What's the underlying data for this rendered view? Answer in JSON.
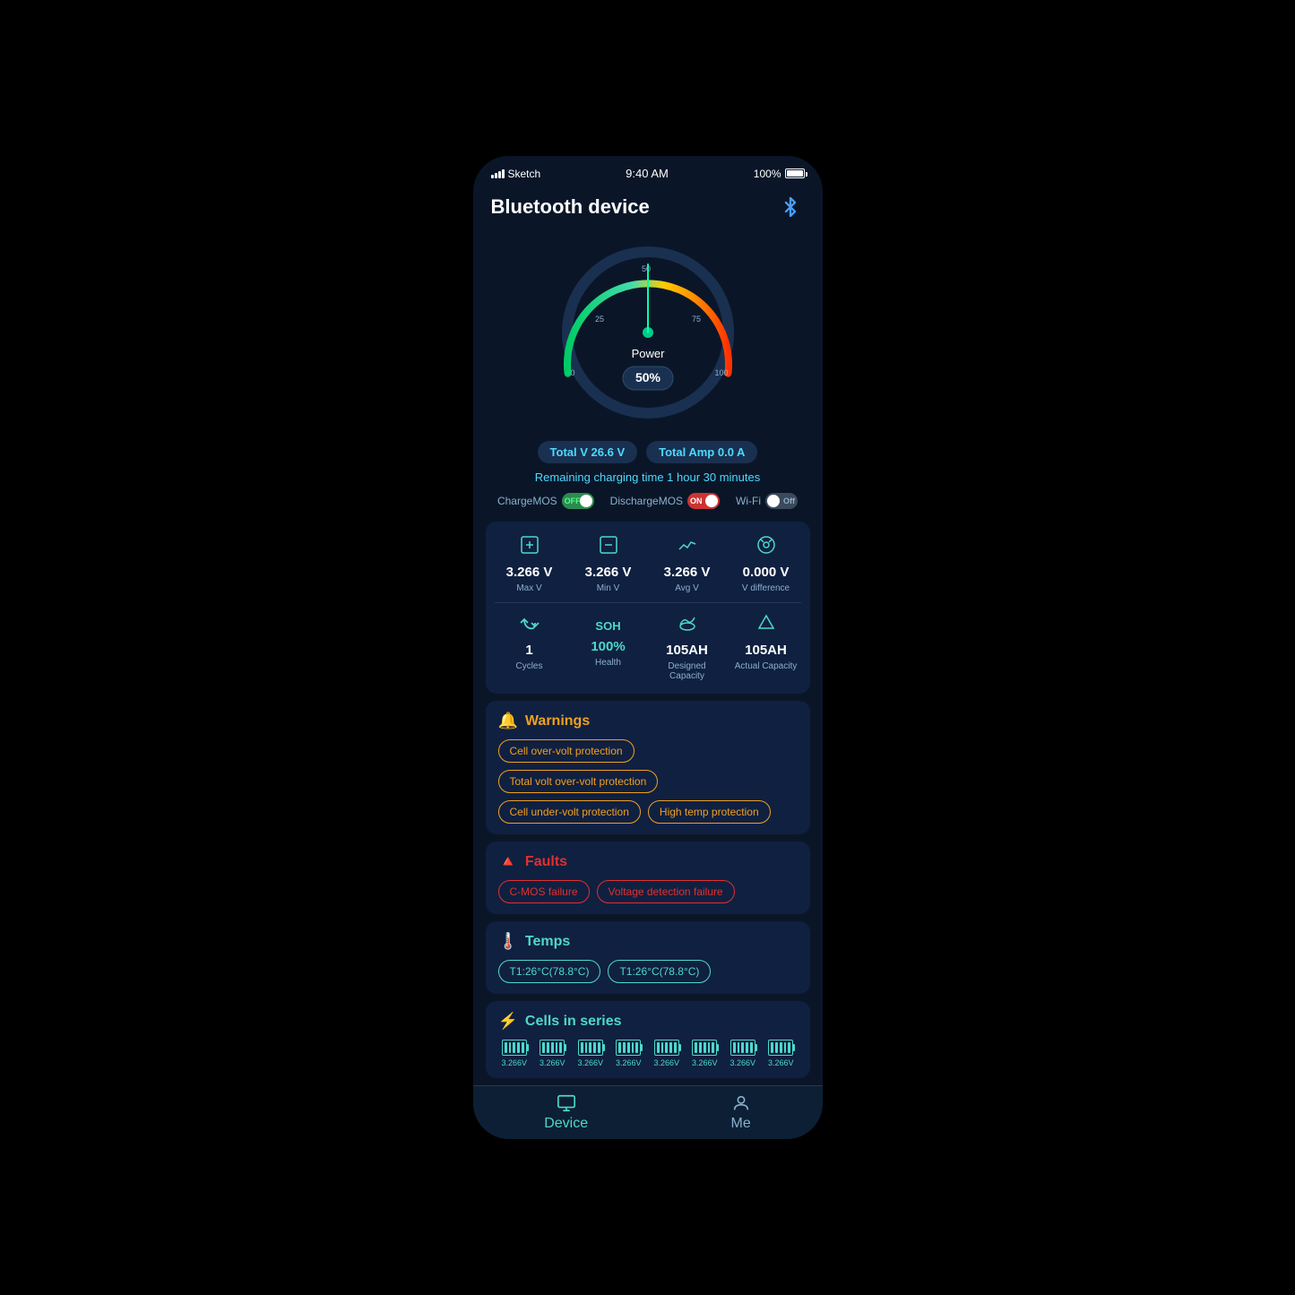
{
  "statusBar": {
    "carrier": "Sketch",
    "time": "9:40 AM",
    "battery": "100%"
  },
  "header": {
    "title": "Bluetooth device",
    "bluetoothIcon": "⚡"
  },
  "gauge": {
    "value": "50%",
    "label": "Power",
    "minLabel": "0",
    "maxLabel": "100",
    "midLabel": "50"
  },
  "stats": {
    "totalVLabel": "Total V",
    "totalVValue": "26.6 V",
    "totalAmpLabel": "Total Amp",
    "totalAmpValue": "0.0 A",
    "chargingTimeLabel": "Remaining charging time",
    "chargingTimeValue": "1 hour 30 minutes"
  },
  "toggles": {
    "chargeMOS": {
      "label": "ChargeMOS",
      "state": "OFF",
      "color": "green"
    },
    "dischargeMOS": {
      "label": "DischargeMOS",
      "state": "ON",
      "color": "red"
    },
    "wifi": {
      "label": "Wi-Fi",
      "state": "OFF",
      "color": "off"
    }
  },
  "dataGrid": {
    "row1": [
      {
        "icon": "⊞",
        "value": "3.266 V",
        "label": "Max V"
      },
      {
        "icon": "⊞",
        "value": "3.266 V",
        "label": "Min V"
      },
      {
        "icon": "≈",
        "value": "3.266 V",
        "label": "Avg V"
      },
      {
        "icon": "◎",
        "value": "0.000 V",
        "label": "V difference"
      }
    ],
    "row2": [
      {
        "icon": "↺",
        "value": "1",
        "label": "Cycles"
      },
      {
        "icon": "SOH",
        "value": "100%",
        "label": "Health",
        "isTeal": true
      },
      {
        "icon": "☁",
        "value": "105AH",
        "label": "Designed Capacity"
      },
      {
        "icon": "⌂",
        "value": "105AH",
        "label": "Actual Capacity"
      }
    ]
  },
  "warnings": {
    "title": "Warnings",
    "tags": [
      "Cell over-volt protection",
      "Total volt over-volt protection",
      "Cell under-volt protection",
      "High temp protection"
    ]
  },
  "faults": {
    "title": "Faults",
    "tags": [
      "C-MOS failure",
      "Voltage detection failure"
    ]
  },
  "temps": {
    "title": "Temps",
    "tags": [
      "T1:26°C(78.8°C)",
      "T1:26°C(78.8°C)"
    ]
  },
  "cells": {
    "title": "Cells in series",
    "values": [
      "3.266V",
      "3.266V",
      "3.266V",
      "3.266V",
      "3.266V",
      "3.266V",
      "3.266V",
      "3.266V"
    ]
  },
  "bottomNav": {
    "items": [
      {
        "label": "Device",
        "active": true
      },
      {
        "label": "Me",
        "active": false
      }
    ]
  }
}
